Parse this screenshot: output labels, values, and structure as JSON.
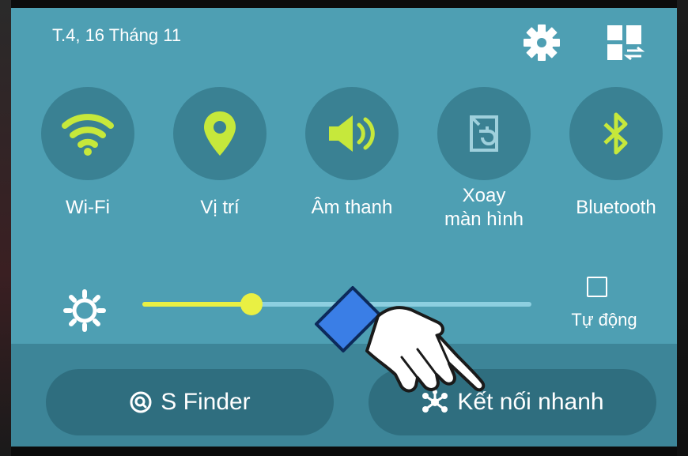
{
  "status": {
    "date": "T.4, 16 Tháng 11"
  },
  "header_icons": {
    "settings_icon": "gear-icon",
    "edit_icon": "tiles-swap-icon"
  },
  "quick_toggles": [
    {
      "label": "Wi-Fi",
      "icon": "wifi-icon",
      "active": true
    },
    {
      "label": "Vị trí",
      "icon": "location-pin-icon",
      "active": true
    },
    {
      "label": "Âm thanh",
      "icon": "speaker-icon",
      "active": true
    },
    {
      "label": "Xoay\nmàn hình",
      "icon": "screen-rotation-icon",
      "active": false
    },
    {
      "label": "Bluetooth",
      "icon": "bluetooth-icon",
      "active": true
    }
  ],
  "brightness": {
    "level": 0.28,
    "auto_label": "Tự động",
    "auto_checked": false
  },
  "buttons": {
    "s_finder": "S Finder",
    "quick_connect": "Kết nối nhanh"
  },
  "colors": {
    "panel": "#4e9fb3",
    "circle": "#3a8193",
    "active_icon": "#c6e83b",
    "inactive_icon": "#9fd0dc",
    "slider": "#e9f043"
  }
}
